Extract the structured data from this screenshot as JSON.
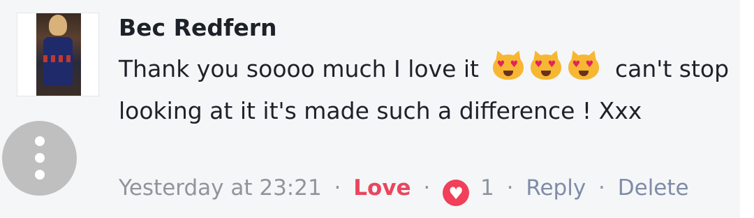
{
  "comment": {
    "author": "Bec Redfern",
    "text_before_emoji": "Thank you soooo much I love it",
    "emojis": [
      "smiling-cat-heart-eyes-icon",
      "smiling-cat-heart-eyes-icon",
      "smiling-cat-heart-eyes-icon"
    ],
    "text_after_emoji": "can't stop looking at it it's made such a difference ! Xxx",
    "timestamp": "Yesterday at 23:21",
    "reaction_label": "Love",
    "reaction_icon": "heart-icon",
    "reaction_count": "1",
    "reply_label": "Reply",
    "delete_label": "Delete",
    "separator": "·"
  },
  "colors": {
    "love": "#e8465f",
    "link": "#7f8ca8",
    "muted": "#90949c",
    "background": "#f5f6f7"
  }
}
